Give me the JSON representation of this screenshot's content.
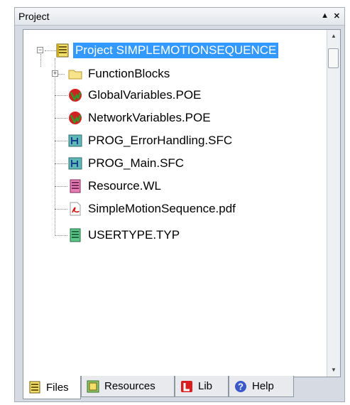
{
  "panel": {
    "title": "Project",
    "buttons": {
      "pin": "▲",
      "close": "✕"
    }
  },
  "tree": {
    "root": {
      "label": "Project SIMPLEMOTIONSEQUENCE",
      "icon": "project-book-icon",
      "expander": "−"
    },
    "items": [
      {
        "label": "FunctionBlocks",
        "icon": "folder-icon",
        "expander": "+"
      },
      {
        "label": "GlobalVariables.POE",
        "icon": "poe-variables-icon"
      },
      {
        "label": "NetworkVariables.POE",
        "icon": "poe-variables-icon"
      },
      {
        "label": "PROG_ErrorHandling.SFC",
        "icon": "sfc-program-icon"
      },
      {
        "label": "PROG_Main.SFC",
        "icon": "sfc-program-icon"
      },
      {
        "label": "Resource.WL",
        "icon": "resource-list-icon"
      },
      {
        "label": "SimpleMotionSequence.pdf",
        "icon": "pdf-icon"
      },
      {
        "label": "USERTYPE.TYP",
        "icon": "usertype-icon"
      }
    ]
  },
  "tabs": [
    {
      "label": "Files",
      "icon": "files-icon",
      "active": true
    },
    {
      "label": "Resources",
      "icon": "resources-icon",
      "active": false
    },
    {
      "label": "Lib",
      "icon": "lib-icon",
      "active": false
    },
    {
      "label": "Help",
      "icon": "help-icon",
      "active": false
    }
  ],
  "colors": {
    "selection": "#3399ff",
    "panel": "#d6dae2"
  }
}
